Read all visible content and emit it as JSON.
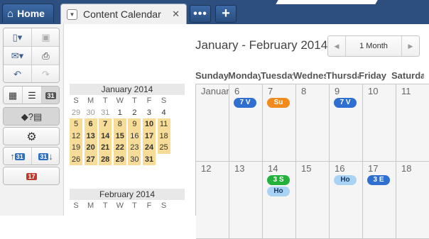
{
  "tabs": {
    "home_label": "Home",
    "calendar_label": "Content Calendar",
    "close_glyph": "✕",
    "more_glyph": "•••",
    "add_glyph": "+"
  },
  "toolbar": {
    "icons": [
      "new-page-icon",
      "save-icon",
      "mail-icon",
      "print-icon",
      "undo-icon",
      "redo-icon",
      "grid-view-icon",
      "timeline-view-icon",
      "calendar-view-icon",
      "workflow-icon",
      "gear-icon",
      "import-ical-icon",
      "export-ical-icon",
      "date-picker-icon"
    ],
    "cal_badge": "31",
    "cal_badge_small": "17"
  },
  "header": {
    "range_title": "January - February 2014",
    "view_select": "1 Month"
  },
  "mini_calendars": [
    {
      "title": "January 2014",
      "weekdays": [
        "S",
        "M",
        "T",
        "W",
        "T",
        "F",
        "S"
      ],
      "weeks": [
        [
          "29",
          "30",
          "31",
          "1",
          "2",
          "3",
          "4"
        ],
        [
          "5",
          "6",
          "7",
          "8",
          "9",
          "10",
          "11"
        ],
        [
          "12",
          "13",
          "14",
          "15",
          "16",
          "17",
          "18"
        ],
        [
          "19",
          "20",
          "21",
          "22",
          "23",
          "24",
          "25"
        ],
        [
          "26",
          "27",
          "28",
          "29",
          "30",
          "31",
          ""
        ]
      ]
    },
    {
      "title": "February 2014",
      "weekdays": [
        "S",
        "M",
        "T",
        "W",
        "T",
        "F",
        "S"
      ]
    }
  ],
  "month_view": {
    "weekday_headers": [
      "Sunday",
      "Monday",
      "Tuesday",
      "Wednesday",
      "Thursday",
      "Friday",
      "Saturday"
    ],
    "week1": [
      {
        "label": "January",
        "events": []
      },
      {
        "label": "6",
        "events": [
          {
            "text": "7 V",
            "style": "blue"
          }
        ]
      },
      {
        "label": "7",
        "events": [
          {
            "text": "Su",
            "style": "orange"
          }
        ]
      },
      {
        "label": "8",
        "events": []
      },
      {
        "label": "9",
        "events": [
          {
            "text": "7 V",
            "style": "blue"
          }
        ]
      },
      {
        "label": "10",
        "events": []
      },
      {
        "label": "11",
        "events": []
      }
    ],
    "week2": [
      {
        "label": "12",
        "events": []
      },
      {
        "label": "13",
        "events": []
      },
      {
        "label": "14",
        "events": [
          {
            "text": "3 S",
            "style": "green"
          },
          {
            "text": "Ho",
            "style": "light"
          }
        ]
      },
      {
        "label": "15",
        "events": []
      },
      {
        "label": "16",
        "events": [
          {
            "text": "Ho",
            "style": "light"
          }
        ]
      },
      {
        "label": "17",
        "events": [
          {
            "text": "3 E",
            "style": "blue"
          }
        ]
      },
      {
        "label": "18",
        "events": []
      }
    ]
  },
  "colors": {
    "topbar": "#2c4f7f",
    "event_blue": "#2e6fd1",
    "event_orange": "#f08a1c",
    "event_green": "#22b13a",
    "event_light": "#a9d3f3",
    "highlight": "#f7dc97"
  }
}
